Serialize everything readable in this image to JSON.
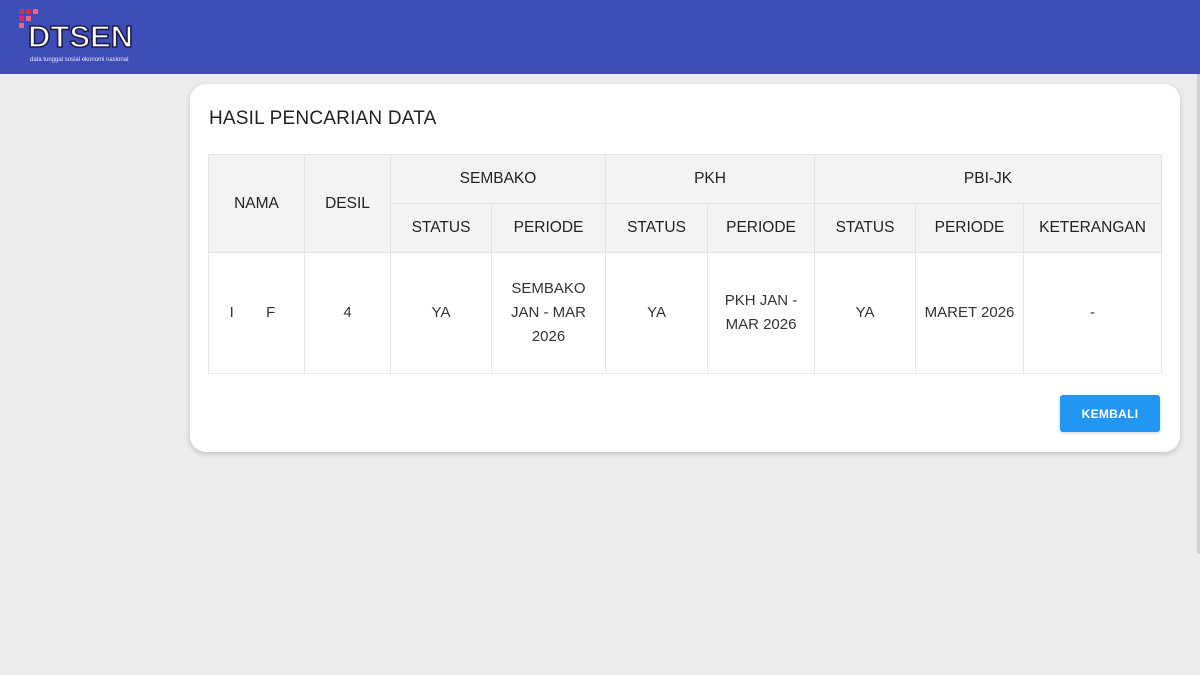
{
  "header": {
    "logo_text": "DTSEN",
    "logo_tagline": "data tunggal sosial ekonomi nasional",
    "background_color": "#3f4db8",
    "logo_accent_color": "#e0245e"
  },
  "card": {
    "title": "HASIL PENCARIAN DATA"
  },
  "table": {
    "groups": {
      "nama": "NAMA",
      "desil": "DESIL",
      "sembako": "SEMBAKO",
      "pkh": "PKH",
      "pbijk": "PBI-JK"
    },
    "subheaders": {
      "sembako_status": "STATUS",
      "sembako_periode": "PERIODE",
      "pkh_status": "STATUS",
      "pkh_periode": "PERIODE",
      "pbijk_status": "STATUS",
      "pbijk_periode": "PERIODE",
      "pbijk_keterangan": "KETERANGAN"
    },
    "rows": [
      {
        "nama": "I  F",
        "desil": "4",
        "sembako_status": "YA",
        "sembako_periode": "SEMBAKO JAN - MAR 2026",
        "pkh_status": "YA",
        "pkh_periode": "PKH JAN - MAR 2026",
        "pbijk_status": "YA",
        "pbijk_periode": "MARET 2026",
        "pbijk_keterangan": "-"
      }
    ]
  },
  "actions": {
    "back_label": "KEMBALI",
    "back_color": "#2196f3"
  }
}
